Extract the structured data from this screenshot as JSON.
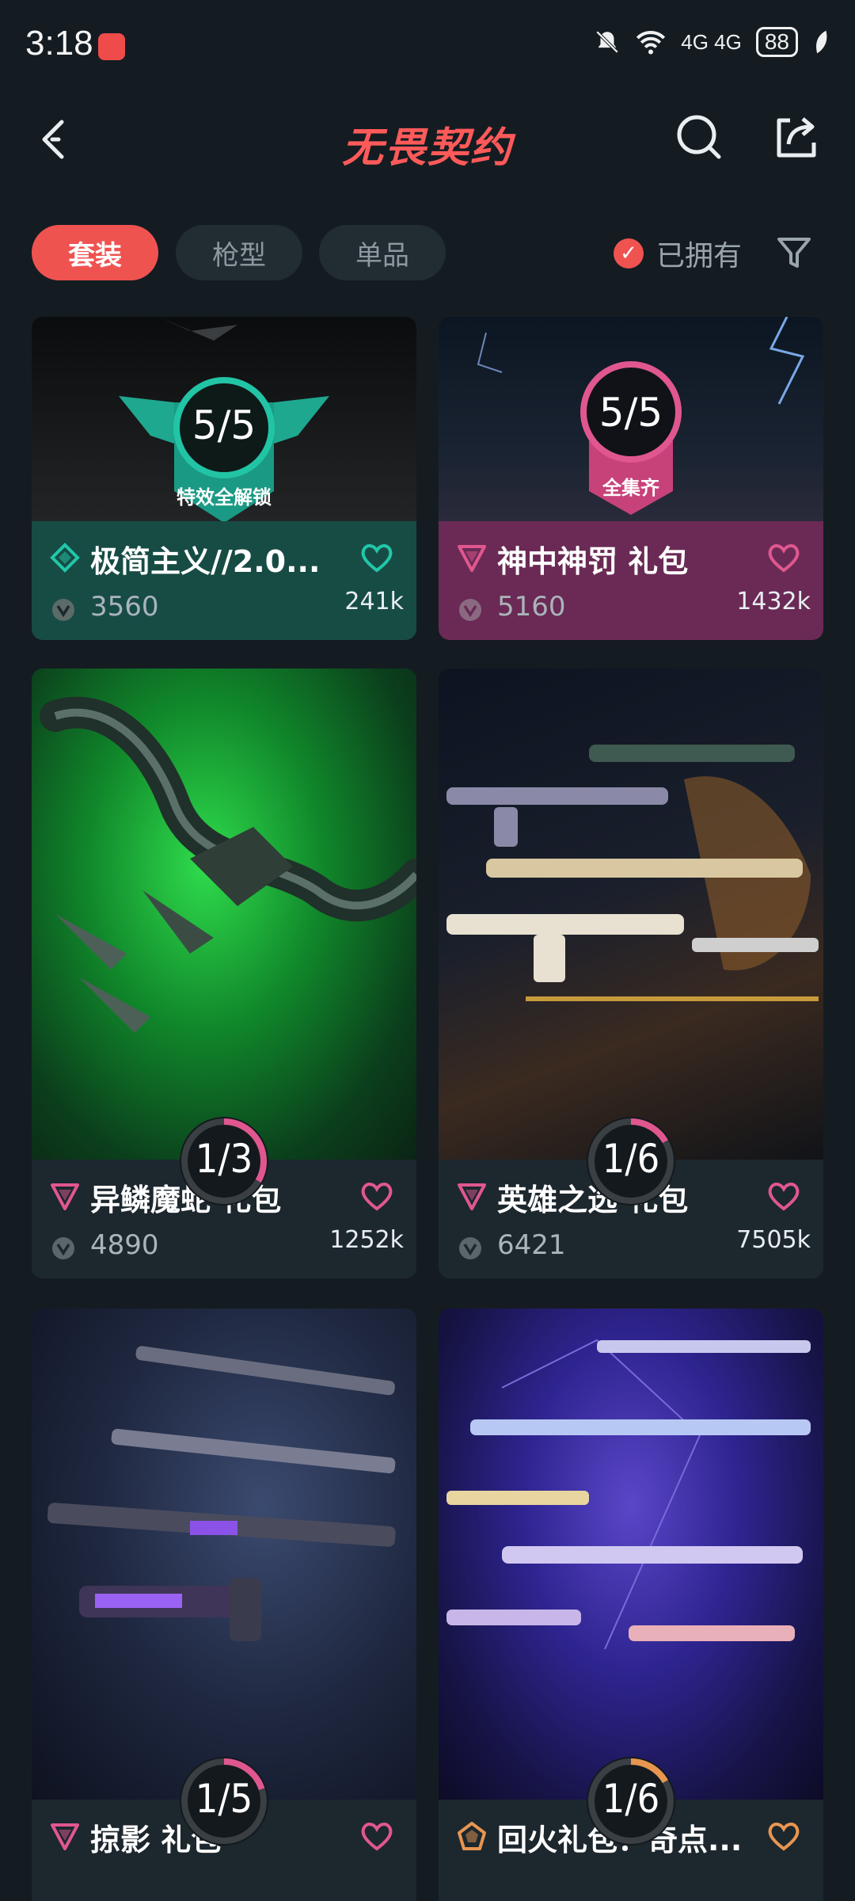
{
  "status": {
    "time": "3:18",
    "network": "4G 4G",
    "battery": "88"
  },
  "header": {
    "title": "无畏契约"
  },
  "tabs": [
    {
      "label": "套装",
      "active": true
    },
    {
      "label": "枪型",
      "active": false
    },
    {
      "label": "单品",
      "active": false
    }
  ],
  "owned_label": "已拥有",
  "cards": [
    {
      "name": "极简主义//2.0...",
      "price": "3560",
      "likes": "241k",
      "progress": "5/5",
      "badge": "特效全解锁",
      "theme": "green"
    },
    {
      "name": "神中神罚 礼包",
      "price": "5160",
      "likes": "1432k",
      "progress": "5/5",
      "badge": "全集齐",
      "theme": "pink"
    },
    {
      "name": "异鳞魔蛇 礼包",
      "price": "4890",
      "likes": "1252k",
      "progress": "1/3",
      "fraction": 0.333
    },
    {
      "name": "英雄之选 礼包",
      "price": "6421",
      "likes": "7505k",
      "progress": "1/6",
      "fraction": 0.167
    },
    {
      "name": "掠影 礼包",
      "progress": "1/5",
      "fraction": 0.2
    },
    {
      "name": "回火礼包：奇点...",
      "progress": "1/6",
      "fraction": 0.167
    }
  ],
  "colors": {
    "accent": "#ef5350",
    "pink": "#e0578f",
    "orange": "#e89550",
    "teal": "#21c7a8"
  }
}
